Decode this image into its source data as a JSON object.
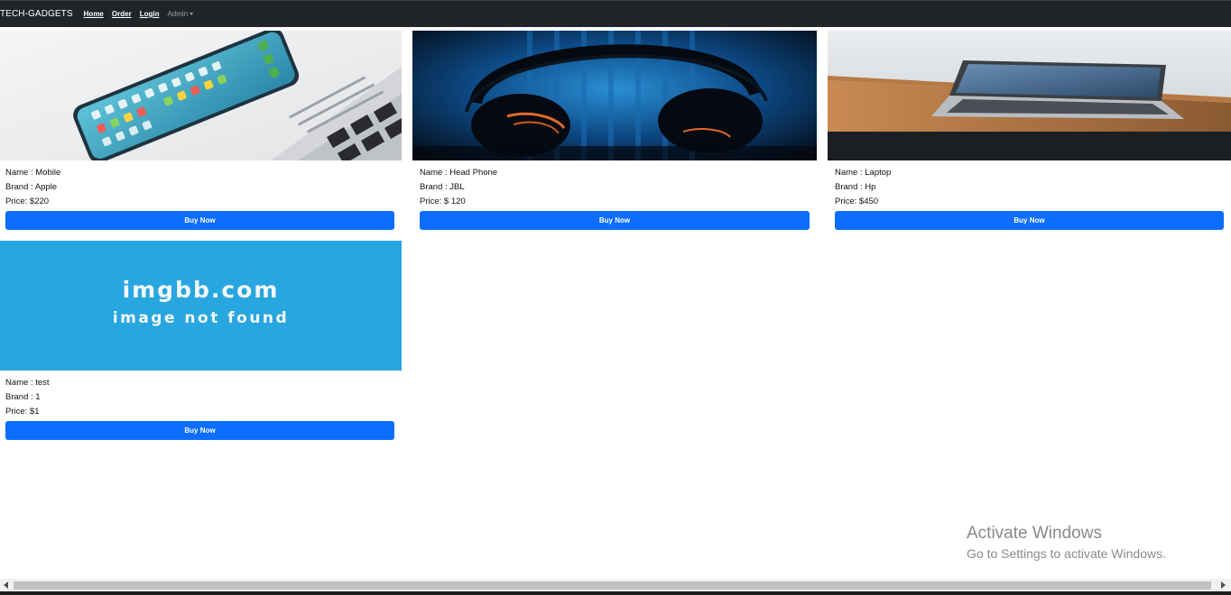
{
  "navbar": {
    "brand": "TECH-GADGETS",
    "links": [
      "Home",
      "Order",
      "Login"
    ],
    "admin_label": "Admin"
  },
  "products": [
    {
      "name": "Name : Mobile",
      "brand": "Brand : Apple",
      "price": "Price: $220",
      "button": "Buy Now"
    },
    {
      "name": "Name : Head Phone",
      "brand": "Brand : JBL",
      "price": "Price: $ 120",
      "button": "Buy Now"
    },
    {
      "name": "Name : Laptop",
      "brand": "Brand : Hp",
      "price": "Price: $450",
      "button": "Buy Now"
    },
    {
      "name": "Name : test",
      "brand": "Brand : 1",
      "price": "Price: $1",
      "button": "Buy Now",
      "image_text": {
        "line1": "imgbb.com",
        "line2": "image not found"
      }
    }
  ],
  "watermark": {
    "title": "Activate Windows",
    "subtitle": "Go to Settings to activate Windows."
  },
  "colors": {
    "navbar_bg": "#212529",
    "button_bg": "#0d6efd",
    "placeholder_bg": "#28a6e0"
  }
}
